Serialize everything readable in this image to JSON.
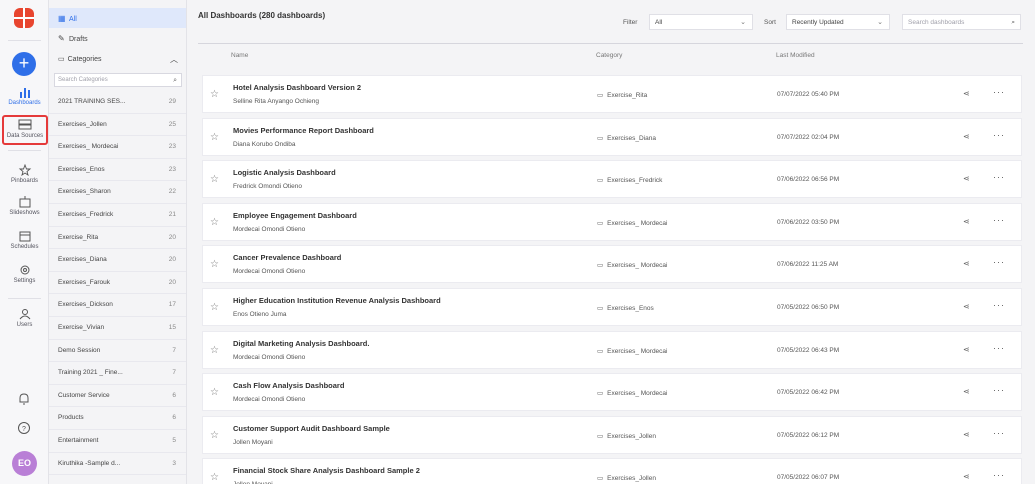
{
  "rail": {
    "items": [
      {
        "label": "Dashboards",
        "icon": "bar-chart-icon",
        "active": true
      },
      {
        "label": "Data Sources",
        "icon": "data-sources-icon",
        "highlight": true
      },
      {
        "label": "Pinboards",
        "icon": "pin-icon"
      },
      {
        "label": "Slideshows",
        "icon": "slideshow-icon"
      },
      {
        "label": "Schedules",
        "icon": "calendar-icon"
      },
      {
        "label": "Settings",
        "icon": "gear-icon"
      },
      {
        "label": "Users",
        "icon": "users-icon"
      }
    ],
    "avatar": "EO",
    "accent": "#2f6fe8",
    "highlight_color": "#e53a3a"
  },
  "catpanel": {
    "all": "All",
    "drafts": "Drafts",
    "categories": "Categories",
    "search_placeholder": "Search Categories",
    "items": [
      {
        "name": "2021 TRAINING SES...",
        "count": "29"
      },
      {
        "name": "Exercises_Jollen",
        "count": "25"
      },
      {
        "name": "Exercises_ Mordecai",
        "count": "23"
      },
      {
        "name": "Exercises_Enos",
        "count": "23"
      },
      {
        "name": "Exercises_Sharon",
        "count": "22"
      },
      {
        "name": "Exercises_Fredrick",
        "count": "21"
      },
      {
        "name": "Exercise_Rita",
        "count": "20"
      },
      {
        "name": "Exercises_Diana",
        "count": "20"
      },
      {
        "name": "Exercises_Farouk",
        "count": "20"
      },
      {
        "name": "Exercises_Dickson",
        "count": "17"
      },
      {
        "name": "Exercise_Vivian",
        "count": "15"
      },
      {
        "name": "Demo Session",
        "count": "7"
      },
      {
        "name": "Training 2021 _ Fine...",
        "count": "7"
      },
      {
        "name": "Customer Service",
        "count": "6"
      },
      {
        "name": "Products",
        "count": "6"
      },
      {
        "name": "Entertainment",
        "count": "5"
      },
      {
        "name": "Kiruthika -Sample d...",
        "count": "3"
      }
    ]
  },
  "main": {
    "title": "All Dashboards (280 dashboards)",
    "filter_label": "Filter",
    "filter_value": "All",
    "sort_label": "Sort",
    "sort_value": "Recently Updated",
    "search_placeholder": "Search dashboards",
    "col_name": "Name",
    "col_category": "Category",
    "col_modified": "Last Modified",
    "rows": [
      {
        "name": "Hotel Analysis Dashboard Version 2",
        "owner": "Selline Rita Anyango Ochieng",
        "category": "Exercise_Rita",
        "modified": "07/07/2022 05:40 PM"
      },
      {
        "name": "Movies Performance Report Dashboard",
        "owner": "Diana Korubo Ondiba",
        "category": "Exercises_Diana",
        "modified": "07/07/2022 02:04 PM"
      },
      {
        "name": "Logistic Analysis Dashboard",
        "owner": "Fredrick Omondi Otieno",
        "category": "Exercises_Fredrick",
        "modified": "07/06/2022 06:56 PM"
      },
      {
        "name": "Employee Engagement Dashboard",
        "owner": "Mordecai Omondi Otieno",
        "category": "Exercises_ Mordecai",
        "modified": "07/06/2022 03:50 PM"
      },
      {
        "name": "Cancer Prevalence Dashboard",
        "owner": "Mordecai Omondi Otieno",
        "category": "Exercises_ Mordecai",
        "modified": "07/06/2022 11:25 AM"
      },
      {
        "name": "Higher Education Institution Revenue Analysis Dashboard",
        "owner": "Enos Otieno Juma",
        "category": "Exercises_Enos",
        "modified": "07/05/2022 06:50 PM"
      },
      {
        "name": "Digital Marketing Analysis Dashboard.",
        "owner": "Mordecai Omondi Otieno",
        "category": "Exercises_ Mordecai",
        "modified": "07/05/2022 06:43 PM"
      },
      {
        "name": "Cash Flow Analysis Dashboard",
        "owner": "Mordecai Omondi Otieno",
        "category": "Exercises_ Mordecai",
        "modified": "07/05/2022 06:42 PM"
      },
      {
        "name": "Customer Support Audit Dashboard Sample",
        "owner": "Jollen Moyani",
        "category": "Exercises_Jollen",
        "modified": "07/05/2022 06:12 PM"
      },
      {
        "name": "Financial Stock Share Analysis Dashboard Sample 2",
        "owner": "Jollen Moyani",
        "category": "Exercises_Jollen",
        "modified": "07/05/2022 06:07 PM"
      }
    ]
  }
}
